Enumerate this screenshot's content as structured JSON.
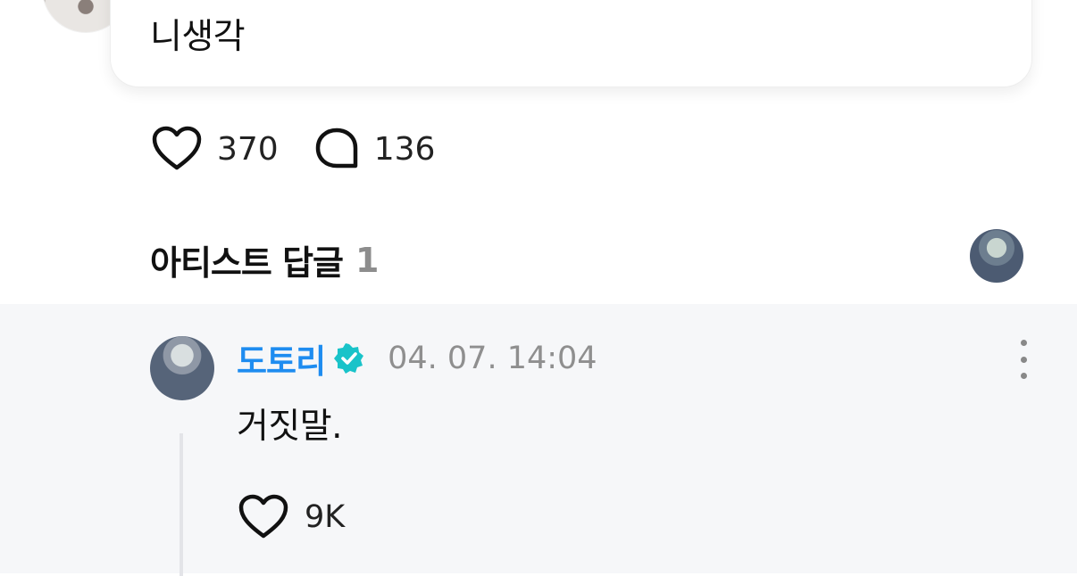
{
  "post": {
    "text": "니생각",
    "likes": "370",
    "comments": "136"
  },
  "icons": {
    "like": "heart-icon",
    "comment": "speech-bubble-icon",
    "verified": "verified-badge-icon",
    "more": "more-vertical-icon"
  },
  "artist_replies": {
    "title": "아티스트 답글",
    "count": "1"
  },
  "reply": {
    "author": "도토리",
    "timestamp": "04. 07. 14:04",
    "text": "거짓말.",
    "likes": "9K"
  },
  "colors": {
    "author_name": "#1e8cf0",
    "verified_badge": "#19c3c9",
    "reply_background": "#f6f7f9",
    "muted_text": "#8f8f8f"
  }
}
